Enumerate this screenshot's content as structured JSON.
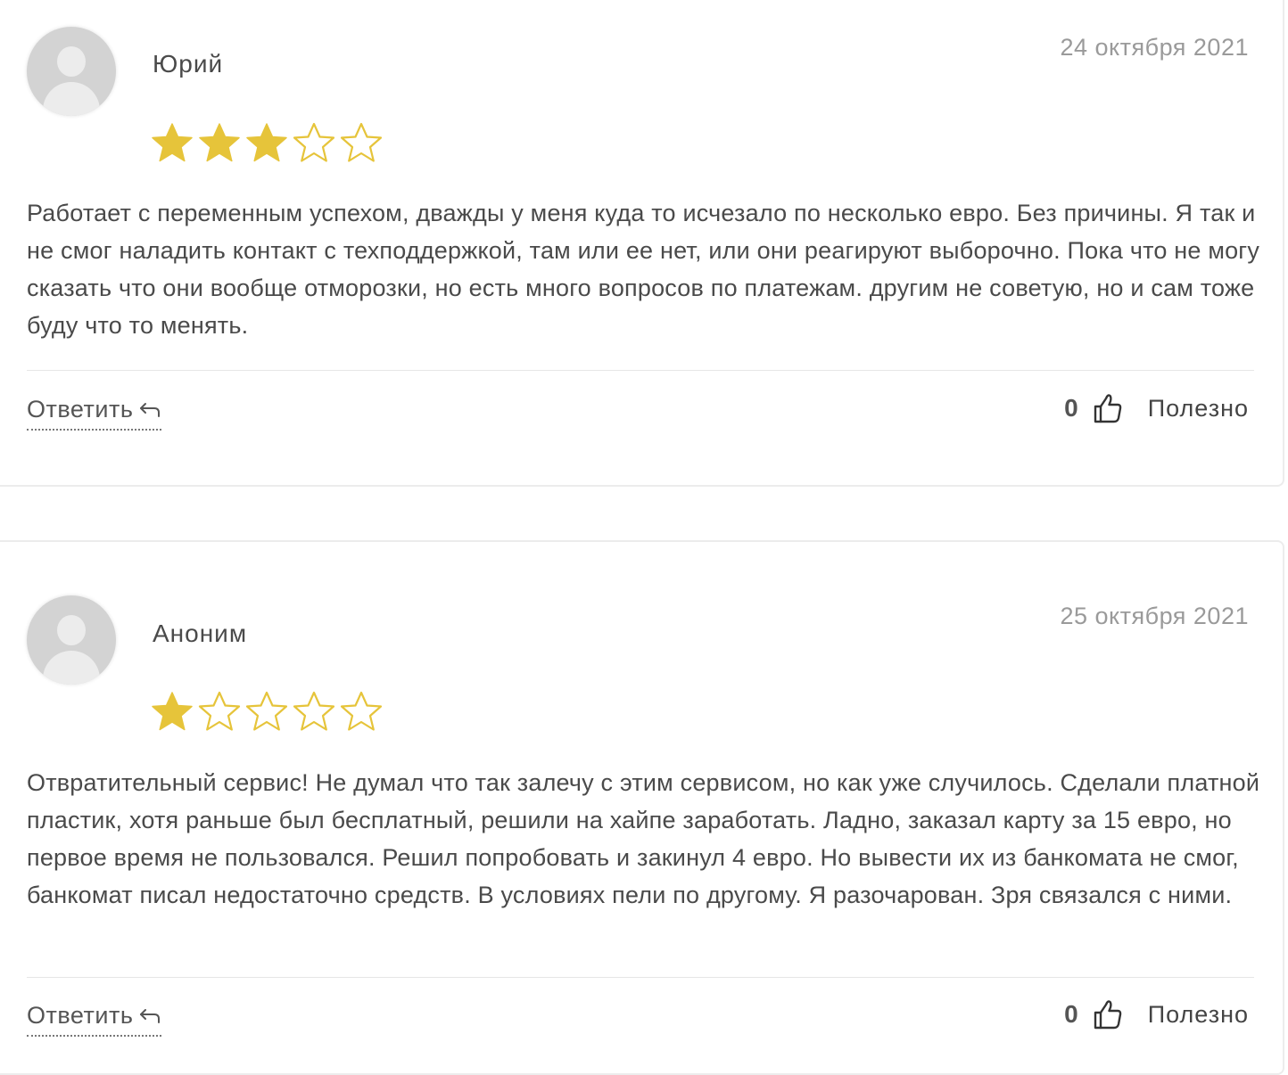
{
  "reviews": [
    {
      "author": "Юрий",
      "date": "24 октября 2021",
      "rating": 3,
      "max_rating": 5,
      "text": "Работает с переменным успехом, дважды у меня куда то исчезало по несколько евро. Без причины. Я так и не смог наладить контакт с техподдержкой, там или ее нет, или они реагируют выборочно. Пока что не могу сказать что они вообще отморозки, но есть много вопросов по платежам. другим не советую, но и сам тоже буду что то менять.",
      "reply_label": "Ответить",
      "useful_count": "0",
      "useful_label": "Полезно"
    },
    {
      "author": "Аноним",
      "date": "25 октября 2021",
      "rating": 1,
      "max_rating": 5,
      "text": "Отвратительный сервис! Не думал что так залечу с этим сервисом, но как уже случилось. Сделали платной пластик, хотя раньше был бесплатный, решили на хайпе заработать. Ладно, заказал карту за 15 евро, но первое время не пользовался. Решил попробовать и закинул 4 евро. Но вывести их из банкомата не смог, банкомат писал недостаточно средств. В условиях пели по другому. Я разочарован. Зря связался с ними.",
      "reply_label": "Ответить",
      "useful_count": "0",
      "useful_label": "Полезно"
    }
  ],
  "icons": {
    "star_filled": "star-icon",
    "star_empty": "star-outline-icon",
    "reply": "reply-arrow-icon",
    "like": "thumbs-up-icon",
    "avatar": "user-placeholder-icon"
  },
  "colors": {
    "star": "#e6c43a",
    "text": "#4a4a4a",
    "date": "#9a9a9a",
    "divider": "#e6e6e6"
  }
}
